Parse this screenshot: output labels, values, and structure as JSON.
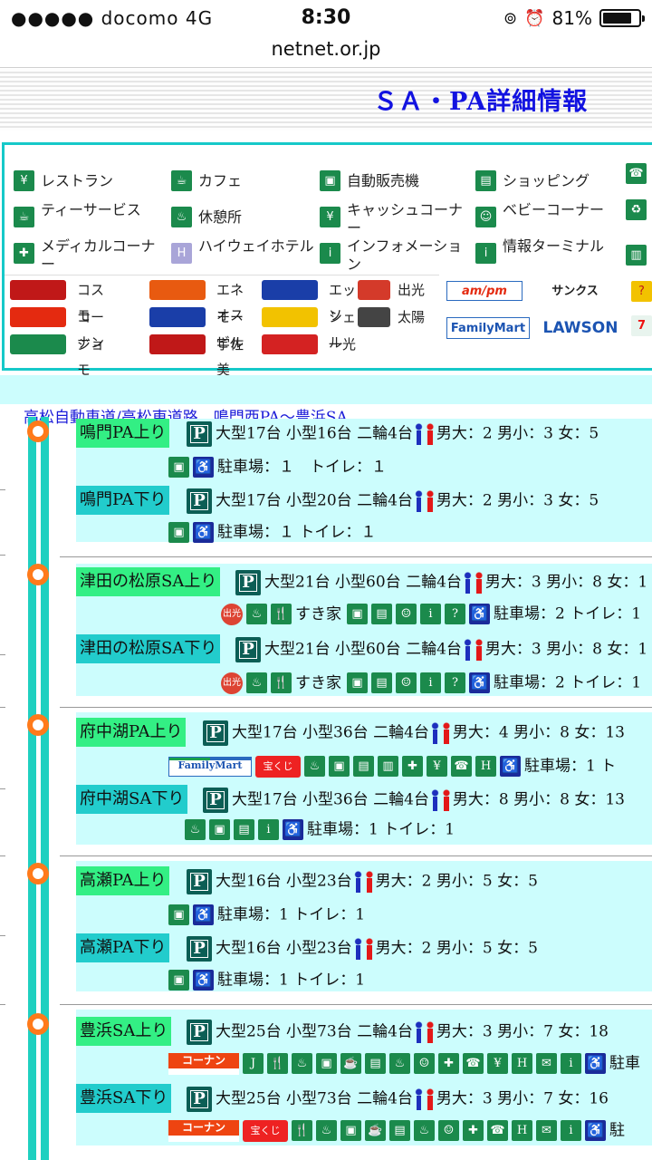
{
  "status_bar": {
    "carrier": "●●●●● docomo   4G",
    "time": "8:30",
    "battery": "81%",
    "battery_level": 0.81
  },
  "browser": {
    "url": "netnet.or.jp"
  },
  "page": {
    "title": "ＳＡ・PA詳細情報"
  },
  "legend": {
    "facilities": [
      {
        "label": "レストラン",
        "icon": "restaurant-icon"
      },
      {
        "label": "カフェ",
        "icon": "cafe-icon"
      },
      {
        "label": "自動販売機",
        "icon": "vending-machine-icon"
      },
      {
        "label": "ショッピング",
        "icon": "shopping-icon"
      },
      {
        "label": "ティーサービス",
        "icon": "tea-service-icon"
      },
      {
        "label": "休憩所",
        "icon": "rest-area-icon"
      },
      {
        "label": "キャッシュコーナー",
        "icon": "cash-corner-icon"
      },
      {
        "label": "ベビーコーナー",
        "icon": "baby-corner-icon"
      },
      {
        "label": "メディカルコーナー",
        "icon": "medical-corner-icon"
      },
      {
        "label": "ハイウェイホテル",
        "icon": "highway-hotel-icon"
      },
      {
        "label": "インフォメーション",
        "icon": "information-icon"
      },
      {
        "label": "情報ターミナル",
        "icon": "info-terminal-icon"
      }
    ],
    "gas_brands": [
      {
        "label": "コスモ",
        "logo": "COSMO",
        "color": "#c01818"
      },
      {
        "label": "エネオス",
        "logo": "ENEOS",
        "color": "#e85a10"
      },
      {
        "label": "エッソ",
        "logo": "Esso",
        "color": "#1a3ea8"
      },
      {
        "label": "出光",
        "logo": "出光",
        "color": "#d43a2a"
      },
      {
        "label": "コーナン",
        "logo": "コーナン",
        "color": "#e42a10"
      },
      {
        "label": "モービル",
        "logo": "Mobil",
        "color": "#1a3ea8"
      },
      {
        "label": "シェル",
        "logo": "Shell",
        "color": "#f2c200"
      },
      {
        "label": "太陽",
        "logo": "SOLATO",
        "color": "#444444"
      },
      {
        "label": "ジョモ",
        "logo": "JOMO",
        "color": "#1b8a4c"
      },
      {
        "label": "宇佐美",
        "logo": "USAMI",
        "color": "#c01818"
      },
      {
        "label": "一光",
        "logo": "IKKO",
        "color": "#d42222"
      }
    ],
    "store_brands": [
      {
        "label": "am/pm",
        "color": "#e42a10"
      },
      {
        "label": "サンクス",
        "color": "#222222"
      },
      {
        "label": "FamilyMart",
        "color": "#1c54b2"
      },
      {
        "label": "LAWSON",
        "color": "#1c54b2"
      }
    ]
  },
  "route": {
    "title": "高松自動車道/高松東道路　鳴門西PA～豊浜SA"
  },
  "areas": [
    {
      "name": "鳴門PA上り",
      "dir": "up",
      "parking": "大型17台 小型16台 二輪4台",
      "toilets": "男大：2 男小：3 女：5",
      "facility_icons": [
        "vending-machine-icon",
        "wheelchair-icon"
      ],
      "extras": [],
      "notes": "駐車場：１　トイレ：１"
    },
    {
      "name": "鳴門PA下り",
      "dir": "down",
      "parking": "大型17台 小型20台 二輪4台",
      "toilets": "男大：2 男小：3 女：5",
      "facility_icons": [
        "vending-machine-icon",
        "wheelchair-icon"
      ],
      "extras": [],
      "notes": "駐車場：１ トイレ：１"
    },
    {
      "name": "津田の松原SA上り",
      "dir": "up",
      "parking": "大型21台 小型60台 二輪4台",
      "toilets": "男大：3 男小：8 女：1",
      "facility_icons": [
        "gas-station-icon",
        "rest-area-icon",
        "restaurant-icon"
      ],
      "extras": [
        "すき家"
      ],
      "more_icons": [
        "vending-machine-icon",
        "shopping-icon",
        "baby-corner-icon",
        "information-icon",
        "help-icon",
        "wheelchair-icon"
      ],
      "notes": "駐車場：2 トイレ：1"
    },
    {
      "name": "津田の松原SA下り",
      "dir": "down",
      "parking": "大型21台 小型60台 二輪4台",
      "toilets": "男大：3 男小：8 女：1",
      "facility_icons": [
        "gas-station-icon",
        "rest-area-icon",
        "restaurant-icon"
      ],
      "extras": [
        "すき家"
      ],
      "more_icons": [
        "vending-machine-icon",
        "shopping-icon",
        "baby-corner-icon",
        "information-icon",
        "help-icon",
        "wheelchair-icon"
      ],
      "notes": "駐車場：2 トイレ：1"
    },
    {
      "name": "府中湖PA上り",
      "dir": "up",
      "parking": "大型17台 小型36台 二輪4台",
      "toilets": "男大：4 男小：8 女：13",
      "facility_icons": [
        "familymart-logo",
        "takarakuji-logo"
      ],
      "extras": [],
      "more_icons": [
        "rest-area-icon",
        "vending-machine-icon",
        "shopping-icon",
        "atm-icon",
        "medical-corner-icon",
        "cash-corner-icon",
        "fax-icon",
        "hotel-icon",
        "wheelchair-icon"
      ],
      "notes": "駐車場：1 ト"
    },
    {
      "name": "府中湖SA下り",
      "dir": "down",
      "parking": "大型17台 小型36台 二輪4台",
      "toilets": "男大：8 男小：8 女：13",
      "facility_icons": [
        "rest-area-icon",
        "vending-machine-icon",
        "shopping-icon",
        "information-icon",
        "wheelchair-icon"
      ],
      "extras": [],
      "notes": "駐車場：1 トイレ：1"
    },
    {
      "name": "高瀬PA上り",
      "dir": "up",
      "parking": "大型16台 小型23台",
      "toilets": "男大：2 男小：5 女：5",
      "facility_icons": [
        "vending-machine-icon",
        "wheelchair-icon"
      ],
      "extras": [],
      "notes": "駐車場：1 トイレ：1"
    },
    {
      "name": "高瀬PA下り",
      "dir": "down",
      "parking": "大型16台 小型23台",
      "toilets": "男大：2 男小：5 女：5",
      "facility_icons": [
        "vending-machine-icon",
        "wheelchair-icon"
      ],
      "extras": [],
      "notes": "駐車場：1 トイレ：1"
    },
    {
      "name": "豊浜SA上り",
      "dir": "up",
      "parking": "大型25台 小型73台 二輪4台",
      "toilets": "男大：3 男小：7 女：18",
      "facility_icons": [
        "kokonan-logo",
        "jomo-logo"
      ],
      "extras": [],
      "more_icons": [
        "restaurant-icon",
        "rest-area-icon",
        "vending-machine-icon",
        "tea-service-icon",
        "shopping-icon",
        "rest-area-icon",
        "baby-corner-icon",
        "medical-corner-icon",
        "fax-icon",
        "cash-corner-icon",
        "hotel-icon",
        "mail-icon",
        "information-icon",
        "wheelchair-icon"
      ],
      "notes": "駐車"
    },
    {
      "name": "豊浜SA下り",
      "dir": "down",
      "parking": "大型25台 小型73台 二輪4台",
      "toilets": "男大：3 男小：7 女：16",
      "facility_icons": [
        "kokonan-logo",
        "takarakuji-logo"
      ],
      "extras": [],
      "more_icons": [
        "restaurant-icon",
        "rest-area-icon",
        "vending-machine-icon",
        "tea-service-icon",
        "shopping-icon",
        "rest-area-icon",
        "baby-corner-icon",
        "medical-corner-icon",
        "fax-icon",
        "hotel-icon",
        "mail-icon",
        "information-icon",
        "wheelchair-icon"
      ],
      "notes": "駐"
    }
  ]
}
